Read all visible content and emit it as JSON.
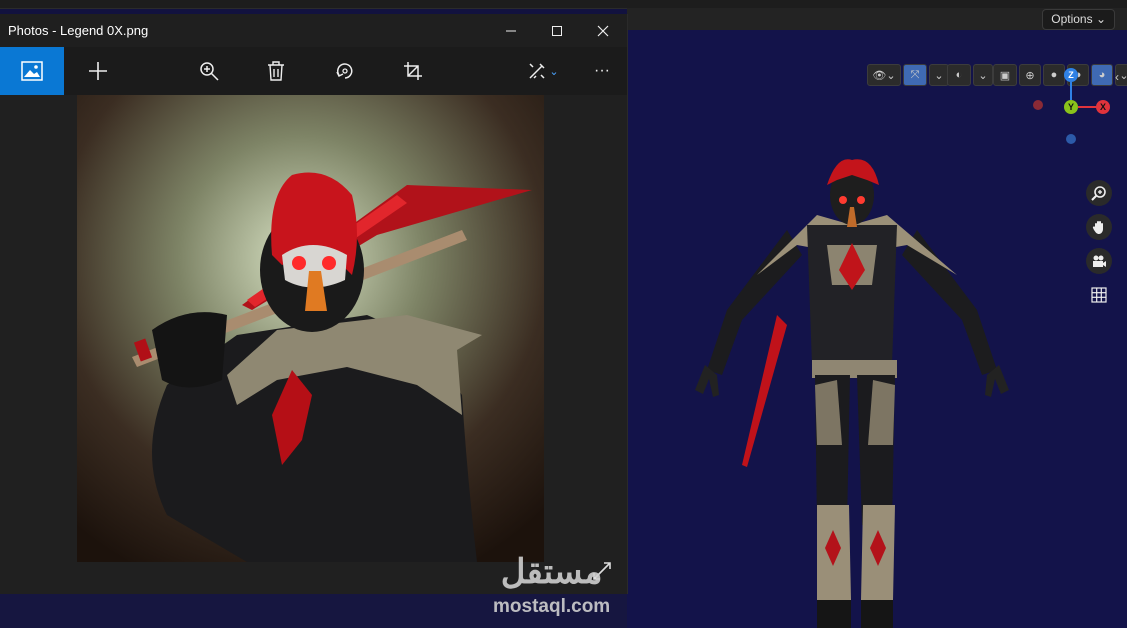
{
  "photos_window": {
    "title": "Photos - Legend 0X.png",
    "controls": {
      "minimize": "minimize-icon",
      "maximize": "maximize-icon",
      "close": "close-icon"
    },
    "toolbar": [
      "photo-icon",
      "plus-icon",
      "zoom-in-icon",
      "trash-icon",
      "rotate-icon",
      "crop-icon",
      "edit-icon",
      "more-icon"
    ],
    "more_glyph": "···"
  },
  "blender": {
    "options_label": "Options",
    "axes": {
      "z": "Z",
      "y": "Y",
      "x": "X"
    },
    "colors": {
      "viewport_bg": "#13134a",
      "x_axis": "#e0333c",
      "y_axis": "#8ac21b",
      "z_axis": "#2f81e5",
      "active": "#3f6ab3"
    }
  },
  "watermark": {
    "arabic": "مستقل",
    "latin": "mostaql.com"
  },
  "accent": "#0a78d4"
}
